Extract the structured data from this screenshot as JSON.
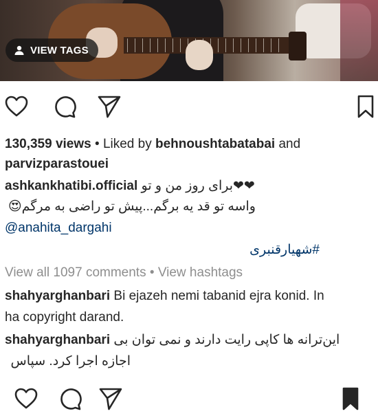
{
  "media": {
    "view_tags_label": "VIEW TAGS"
  },
  "post": {
    "views": "130,359 views",
    "separator": " • ",
    "liked_by_prefix": "Liked by ",
    "liked_user_1": "behnoushtabatabai",
    "and": " and",
    "liked_user_2": "parvizparastouei"
  },
  "caption": {
    "username": "ashkankhatibi.official",
    "line1": "❤❤برای روز من و تو",
    "line2": "واسه تو قد یه برگم...پیش تو راضی به مرگم😍",
    "mention": "@anahita_dargahi",
    "hashtag": "#شهیارقنبری"
  },
  "comments_meta": {
    "view_all": "View all 1097 comments",
    "separator": " • ",
    "view_hashtags": "View hashtags"
  },
  "comments": [
    {
      "username": "shahyarghanbari",
      "line1": "Bi ejazeh nemi tabanid ejra konid. In",
      "line2": "ha copyright darand."
    },
    {
      "username": "shahyarghanbari",
      "line1": "این‌ترانه ها کاپی رایت دارند و نمی توان بی",
      "line2": "اجازه اجرا کرد. سپاس"
    }
  ],
  "icons": {
    "like": "heart-outline-icon",
    "comment": "comment-bubble-icon",
    "share": "paper-plane-icon",
    "save_outline": "bookmark-outline-icon",
    "save_filled": "bookmark-filled-icon",
    "person": "person-icon"
  }
}
